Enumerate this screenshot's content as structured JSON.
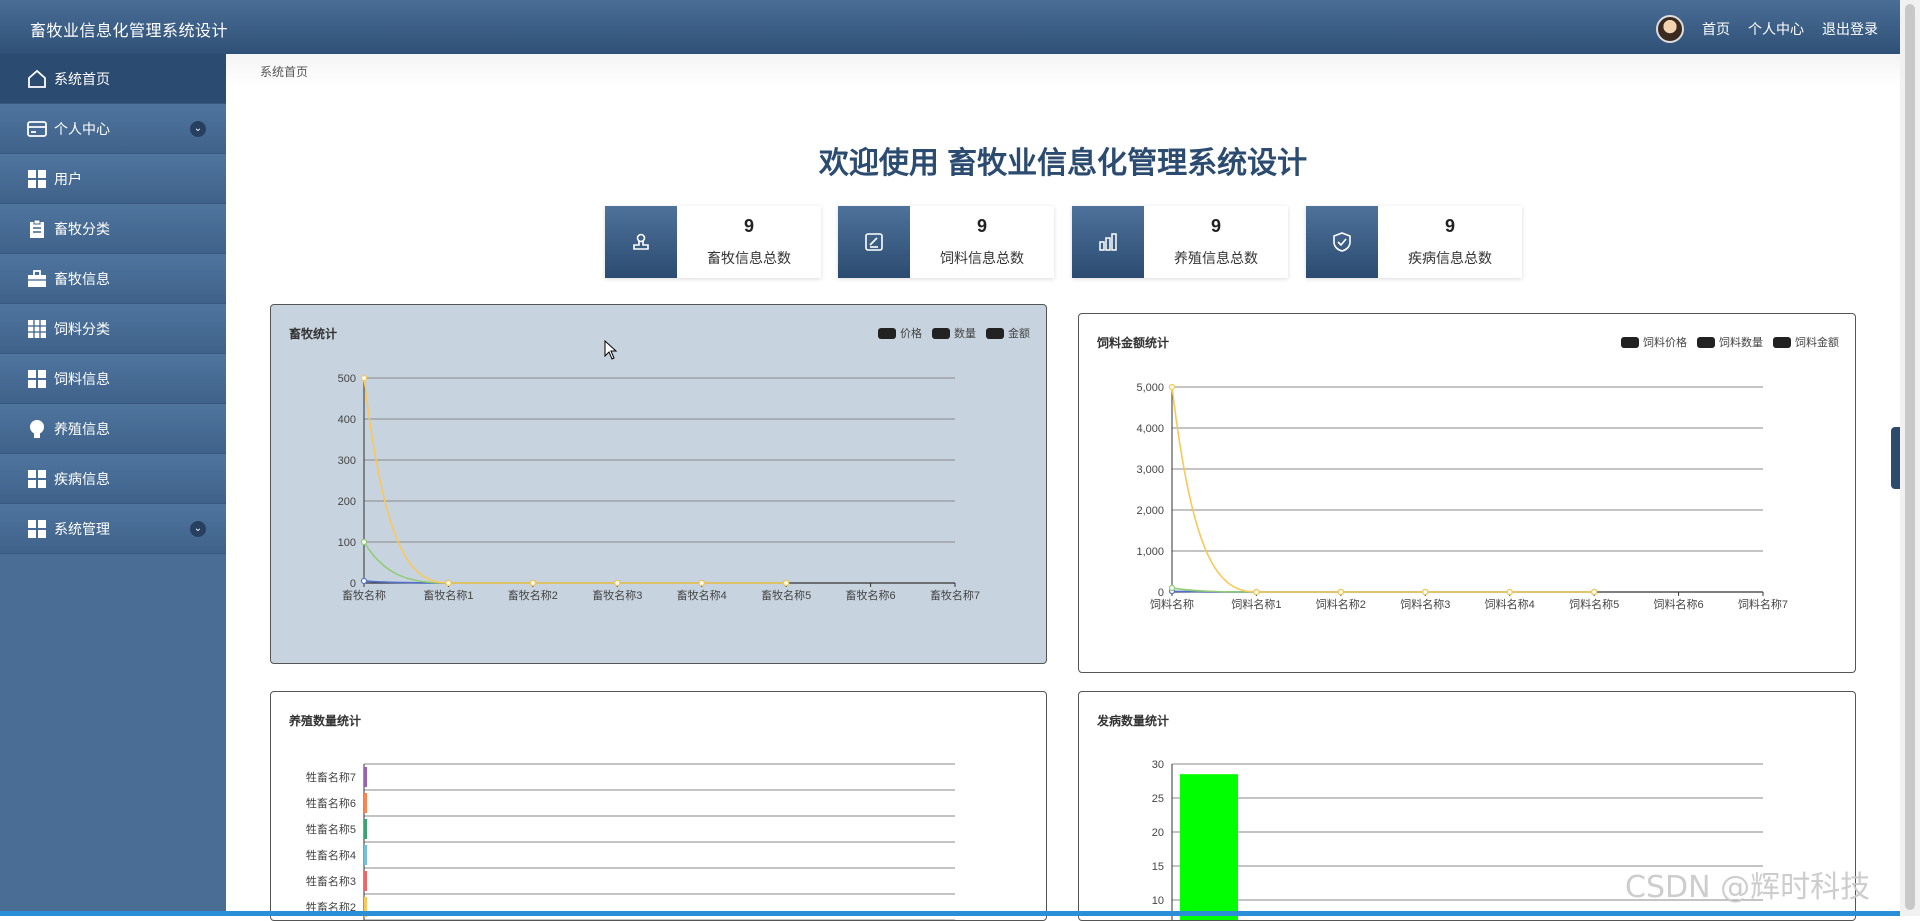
{
  "header": {
    "title": "畜牧业信息化管理系统设计",
    "nav": [
      "首页",
      "个人中心",
      "退出登录"
    ]
  },
  "sidebar": {
    "items": [
      {
        "label": "系统首页",
        "icon": "home-icon",
        "active": true,
        "expandable": false
      },
      {
        "label": "个人中心",
        "icon": "card-icon",
        "active": false,
        "expandable": true
      },
      {
        "label": "用户",
        "icon": "grid-icon",
        "active": false,
        "expandable": false
      },
      {
        "label": "畜牧分类",
        "icon": "clipboard-icon",
        "active": false,
        "expandable": false
      },
      {
        "label": "畜牧信息",
        "icon": "briefcase-icon",
        "active": false,
        "expandable": false
      },
      {
        "label": "饲料分类",
        "icon": "table-grid-icon",
        "active": false,
        "expandable": false
      },
      {
        "label": "饲料信息",
        "icon": "grid-icon",
        "active": false,
        "expandable": false
      },
      {
        "label": "养殖信息",
        "icon": "bulb-icon",
        "active": false,
        "expandable": false
      },
      {
        "label": "疾病信息",
        "icon": "grid-icon",
        "active": false,
        "expandable": false
      },
      {
        "label": "系统管理",
        "icon": "grid-icon",
        "active": false,
        "expandable": true
      }
    ]
  },
  "breadcrumb": "系统首页",
  "welcome": "欢迎使用 畜牧业信息化管理系统设计",
  "stats": [
    {
      "value": "9",
      "label": "畜牧信息总数",
      "icon": "stamp-icon"
    },
    {
      "value": "9",
      "label": "饲料信息总数",
      "icon": "edit-icon"
    },
    {
      "value": "9",
      "label": "养殖信息总数",
      "icon": "bar-chart-icon"
    },
    {
      "value": "9",
      "label": "疾病信息总数",
      "icon": "shield-check-icon"
    }
  ],
  "chart_data": [
    {
      "type": "line",
      "title": "畜牧统计",
      "categories": [
        "畜牧名称",
        "畜牧名称1",
        "畜牧名称2",
        "畜牧名称3",
        "畜牧名称4",
        "畜牧名称5",
        "畜牧名称6",
        "畜牧名称7"
      ],
      "ylim": [
        0,
        500
      ],
      "yticks": [
        0,
        100,
        200,
        300,
        400,
        500
      ],
      "series": [
        {
          "name": "价格",
          "color": "#5470c6",
          "values": [
            5,
            0,
            0,
            0,
            0,
            0
          ]
        },
        {
          "name": "数量",
          "color": "#91cc75",
          "values": [
            100,
            0,
            0,
            0,
            0,
            0
          ]
        },
        {
          "name": "金额",
          "color": "#fac858",
          "values": [
            500,
            0,
            0,
            0,
            0,
            0
          ]
        }
      ],
      "legend": "top-right",
      "grid": true
    },
    {
      "type": "line",
      "title": "饲料金额统计",
      "categories": [
        "饲料名称",
        "饲料名称1",
        "饲料名称2",
        "饲料名称3",
        "饲料名称4",
        "饲料名称5",
        "饲料名称6",
        "饲料名称7"
      ],
      "ylim": [
        0,
        5000
      ],
      "yticks": [
        "0",
        "1,000",
        "2,000",
        "3,000",
        "4,000",
        "5,000"
      ],
      "series": [
        {
          "name": "饲料价格",
          "color": "#5470c6",
          "values": [
            20,
            0,
            0,
            0,
            0,
            0
          ]
        },
        {
          "name": "饲料数量",
          "color": "#91cc75",
          "values": [
            100,
            0,
            0,
            0,
            0,
            0
          ]
        },
        {
          "name": "饲料金额",
          "color": "#fac858",
          "values": [
            5000,
            0,
            0,
            0,
            0,
            0
          ]
        }
      ],
      "legend": "top-right",
      "grid": true
    },
    {
      "type": "bar",
      "orientation": "horizontal",
      "title": "养殖数量统计",
      "categories": [
        "牲畜名称2",
        "牲畜名称3",
        "牲畜名称4",
        "牲畜名称5",
        "牲畜名称6",
        "牲畜名称7"
      ],
      "colors": [
        "#fac858",
        "#ee6666",
        "#73c0de",
        "#3ba272",
        "#fc8452",
        "#9a60b4"
      ],
      "values": [
        1,
        1,
        1,
        1,
        1,
        1
      ],
      "grid": true
    },
    {
      "type": "bar",
      "title": "发病数量统计",
      "yticks": [
        10,
        15,
        20,
        25,
        30
      ],
      "values": [
        28.5
      ],
      "color": "#00ff00",
      "grid": true
    }
  ],
  "watermark": "CSDN @辉时科技"
}
